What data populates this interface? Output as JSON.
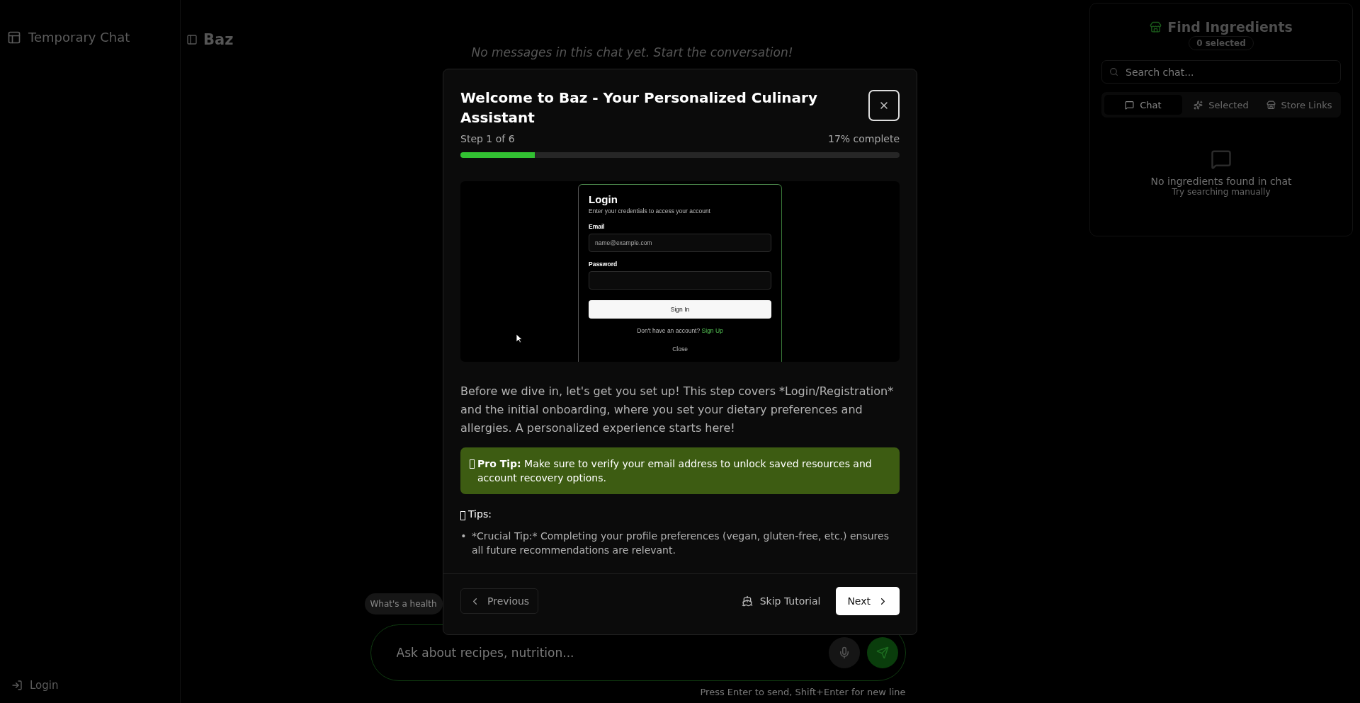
{
  "sidebar": {
    "title": "Temporary Chat",
    "login": "Login"
  },
  "header": {
    "title": "Baz"
  },
  "chat": {
    "empty_message": "No messages in this chat yet. Start the conversation!",
    "suggestions": [
      "What's a health"
    ],
    "input": {
      "placeholder": "Ask about recipes, nutrition..."
    },
    "hint": "Press Enter to send, Shift+Enter for new line"
  },
  "ingredients_panel": {
    "title": "Find Ingredients",
    "badge": "0 selected",
    "search": {
      "placeholder": "Search chat..."
    },
    "tabs": [
      {
        "label": "Chat",
        "selected": true,
        "kind": "chat"
      },
      {
        "label": "Selected",
        "selected": false,
        "kind": "selected"
      },
      {
        "label": "Store Links",
        "selected": false,
        "kind": "store"
      }
    ],
    "empty_title": "No ingredients found in chat",
    "empty_subtitle": "Try searching manually"
  },
  "dialog": {
    "title": "Welcome to Baz - Your Personalized Culinary Assistant",
    "step": "Step 1 of 6",
    "percent": "17% complete",
    "progress": {
      "level": 0.17
    },
    "screenshot": {
      "title": "Login",
      "subtitle": "Enter your credentials to access your account",
      "email_label": "Email",
      "email_placeholder": "name@example.com",
      "password_label": "Password",
      "sign_in": "Sign In",
      "signup_prompt": "Don't have an account?",
      "signup_link": "Sign Up",
      "close": "Close"
    },
    "description": "Before we dive in, let's get you set up! This step covers *Login/Registration* and the initial onboarding, where you set your dietary preferences and allergies. A personalized experience starts here!",
    "pro_tip": "**Pro Tip:** Make sure to verify your email address to unlock saved resources and account recovery options.",
    "tips_heading": "Tips:",
    "tips": [
      {
        "bullet": "•",
        "text": "*Crucial Tip:* Completing your profile preferences (vegan, gluten-free, etc.) ensures all future recommendations are relevant."
      }
    ],
    "buttons": {
      "previous": "Previous",
      "skip": "Skip Tutorial",
      "next": "Next"
    }
  }
}
